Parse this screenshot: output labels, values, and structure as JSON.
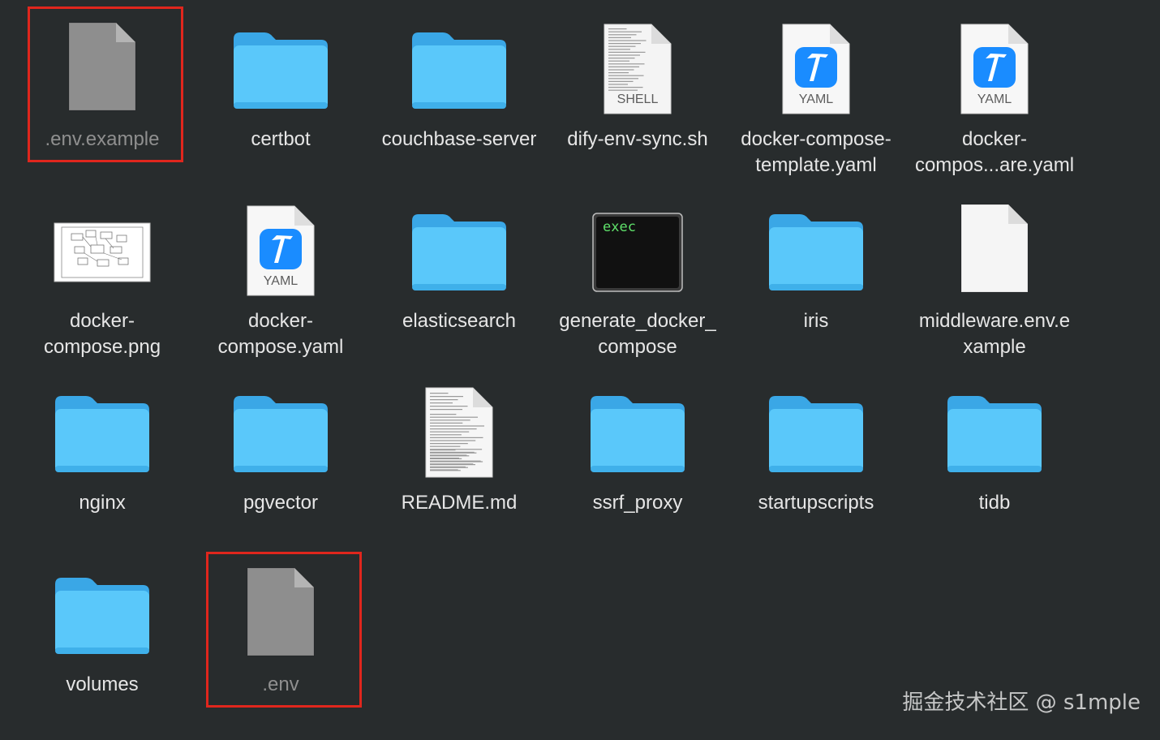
{
  "files": [
    {
      "name": ".env.example",
      "kind": "hidden-doc",
      "highlighted": true
    },
    {
      "name": "certbot",
      "kind": "folder"
    },
    {
      "name": "couchbase-server",
      "kind": "folder"
    },
    {
      "name": "dify-env-sync.sh",
      "kind": "shell",
      "badge": "SHELL"
    },
    {
      "name": "docker-compose-\ntemplate.yaml",
      "kind": "yaml",
      "badge": "YAML"
    },
    {
      "name": "docker-\ncompos...are.yaml",
      "kind": "yaml",
      "badge": "YAML"
    },
    {
      "name": "docker-\ncompose.png",
      "kind": "image"
    },
    {
      "name": "docker-\ncompose.yaml",
      "kind": "yaml",
      "badge": "YAML"
    },
    {
      "name": "elasticsearch",
      "kind": "folder"
    },
    {
      "name": "generate_docker_\ncompose",
      "kind": "exec",
      "badge": "exec"
    },
    {
      "name": "iris",
      "kind": "folder"
    },
    {
      "name": "middleware.env.e\nxample",
      "kind": "doc"
    },
    {
      "name": "nginx",
      "kind": "folder"
    },
    {
      "name": "pgvector",
      "kind": "folder"
    },
    {
      "name": "README.md",
      "kind": "text"
    },
    {
      "name": "ssrf_proxy",
      "kind": "folder"
    },
    {
      "name": "startupscripts",
      "kind": "folder"
    },
    {
      "name": "tidb",
      "kind": "folder"
    },
    {
      "name": "volumes",
      "kind": "folder"
    },
    {
      "name": ".env",
      "kind": "hidden-doc",
      "highlighted": true
    }
  ],
  "watermark": "掘金技术社区 @ s1mple",
  "colors": {
    "background": "#282c2d",
    "folder": "#5ac8fa",
    "highlight": "#e0261d",
    "hidden_doc": "#8e8e8e"
  }
}
